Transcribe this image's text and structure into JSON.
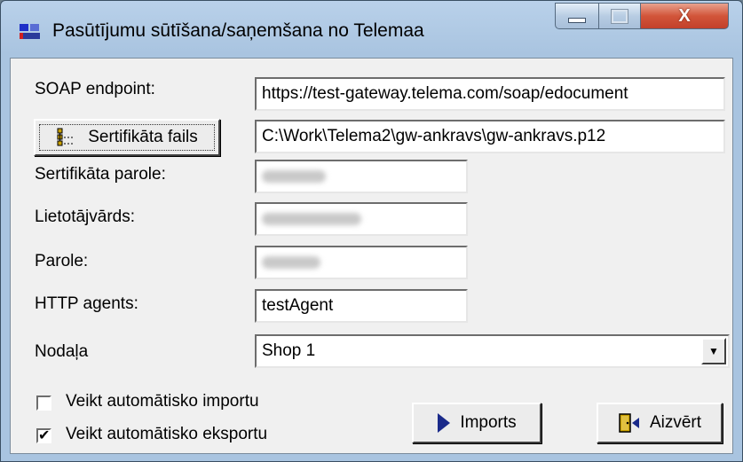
{
  "window": {
    "title": "Pasūtījumu sūtīšana/saņemšana no Telemaa",
    "close_glyph": "X"
  },
  "form": {
    "soap_label": "SOAP endpoint:",
    "soap_value": "https://test-gateway.telema.com/soap/edocument",
    "cert_button_label": "Sertifikāta fails",
    "cert_file_value": "C:\\Work\\Telema2\\gw-ankravs\\gw-ankravs.p12",
    "cert_password_label": "Sertifikāta parole:",
    "username_label": "Lietotājvārds:",
    "password_label": "Parole:",
    "http_agent_label": "HTTP agents:",
    "http_agent_value": "testAgent",
    "department_label": "Nodaļa",
    "department_value": "Shop 1"
  },
  "options": {
    "auto_import_label": "Veikt automātisko importu",
    "auto_import_checked": false,
    "auto_export_label": "Veikt automātisko eksportu",
    "auto_export_checked": true,
    "check_glyph": "✔"
  },
  "buttons": {
    "imports_label": "Imports",
    "close_label": "Aizvērt"
  },
  "icons": {
    "app": "app-icon",
    "certificate": "certificate-tree-icon",
    "imports": "play-arrow-icon",
    "close": "exit-door-icon",
    "dropdown": "chevron-down-icon"
  }
}
